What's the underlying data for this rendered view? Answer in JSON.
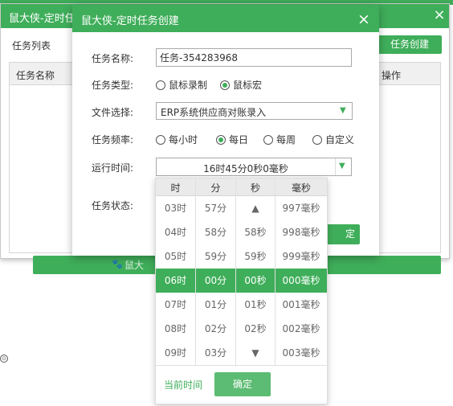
{
  "back_window": {
    "title": "鼠大侠-定时任",
    "close": "×",
    "list_label": "任务列表",
    "create_button": "任务创建",
    "columns": [
      "任务名称",
      "操作"
    ],
    "bottom_label": "鼠大"
  },
  "dialog": {
    "title": "鼠大侠-定时任务创建",
    "close": "×",
    "labels": {
      "name": "任务名称:",
      "type": "任务类型:",
      "file": "文件选择:",
      "freq": "任务频率:",
      "time": "运行时间:",
      "status": "任务状态:"
    },
    "name_value": "任务-354283968",
    "type_options": [
      {
        "label": "鼠标录制",
        "selected": false
      },
      {
        "label": "鼠标宏",
        "selected": true
      }
    ],
    "file_value": "ERP系统供应商对账录入",
    "freq_options": [
      {
        "label": "每小时",
        "selected": false
      },
      {
        "label": "每日",
        "selected": true
      },
      {
        "label": "每周",
        "selected": false
      },
      {
        "label": "自定义",
        "selected": false
      }
    ],
    "time_value": "16时45分0秒0毫秒",
    "ok_button_partial": "定"
  },
  "time_picker": {
    "headers": [
      "时",
      "分",
      "秒",
      "毫秒"
    ],
    "hours": [
      "03时",
      "04时",
      "05时",
      "06时",
      "07时",
      "08时",
      "09时"
    ],
    "minutes": [
      "57分",
      "58分",
      "59分",
      "00分",
      "01分",
      "02分",
      "03分"
    ],
    "seconds": [
      "▲",
      "58秒",
      "59秒",
      "00秒",
      "01秒",
      "02秒",
      "▼"
    ],
    "milliseconds": [
      "997毫秒",
      "998毫秒",
      "999毫秒",
      "000毫秒",
      "001毫秒",
      "002毫秒",
      "003毫秒"
    ],
    "now_link": "当前时间",
    "ok_button": "确定"
  },
  "colors": {
    "accent": "#3fae5a",
    "accent_light": "#5dbc73"
  },
  "icons": {
    "dropdown": "▼",
    "paw": "🐾"
  }
}
